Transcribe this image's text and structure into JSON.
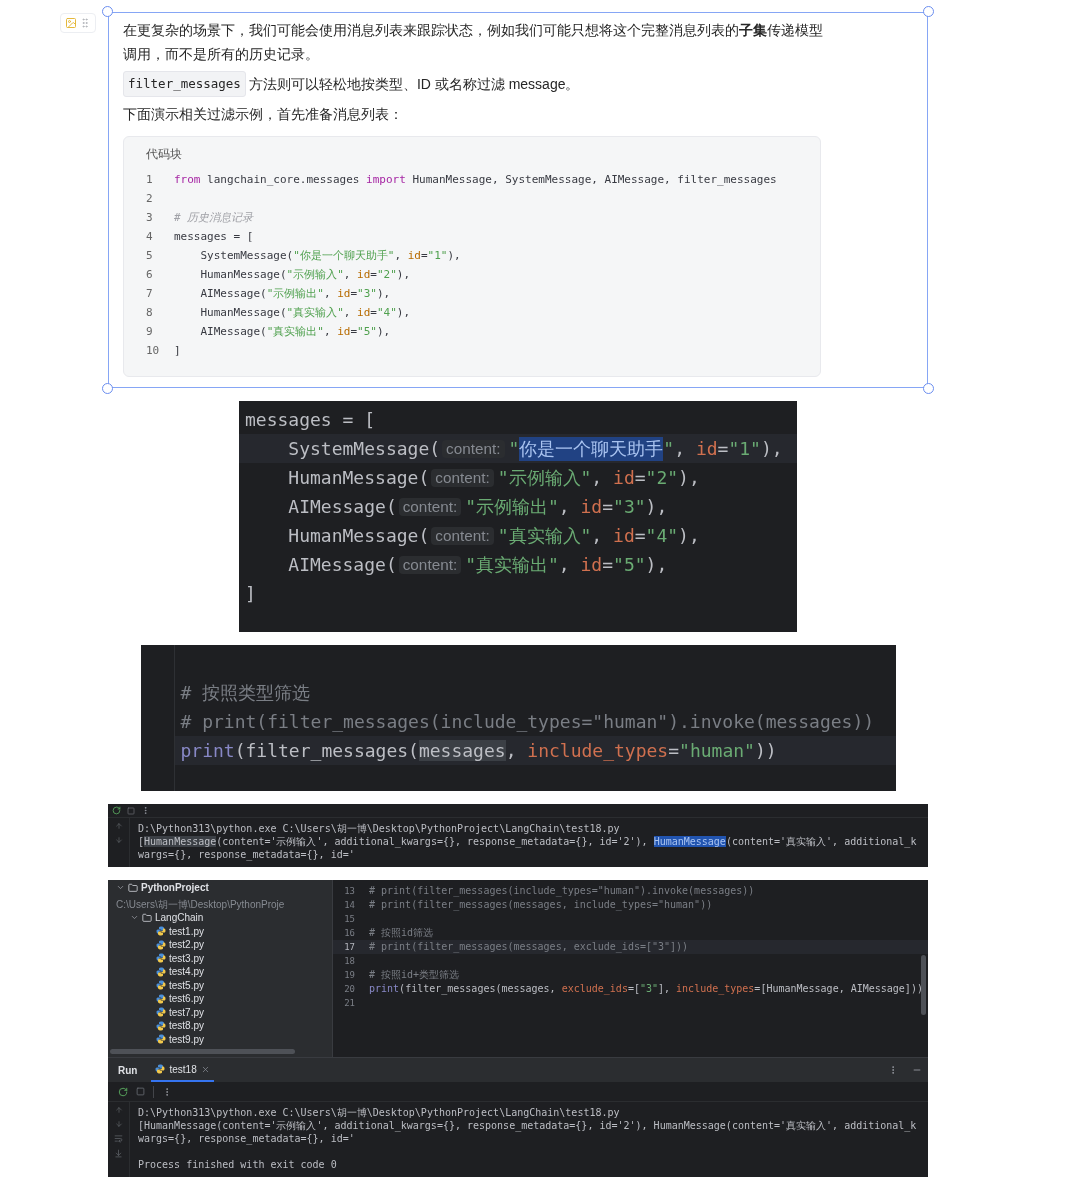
{
  "doc_block": {
    "paragraphs": [
      {
        "kind": "text",
        "text": "在更复杂的场景下，我们可能会使用消息列表来跟踪状态，例如我们可能只想将这个完整消息列表的**子集**传递模型调用，而不是所有的历史记录。"
      },
      {
        "kind": "code_lead",
        "code": "filter_messages",
        "text": "方法则可以轻松地按类型、ID 或名称过滤 message。"
      },
      {
        "kind": "text",
        "text": "下面演示相关过滤示例，首先准备消息列表："
      }
    ],
    "code_block": {
      "label": "代码块",
      "lines": [
        {
          "number": "1",
          "tokens": [
            {
              "kind": "keyword",
              "text": "from"
            },
            {
              "kind": "plain",
              "text": " langchain_core.messages "
            },
            {
              "kind": "keyword",
              "text": "import"
            },
            {
              "kind": "plain",
              "text": " HumanMessage, SystemMessage, AIMessage, filter_messages"
            }
          ]
        },
        {
          "number": "2"
        },
        {
          "number": "3",
          "tokens": [
            {
              "kind": "comment",
              "text": "# 历史消息记录"
            }
          ]
        },
        {
          "number": "4",
          "tokens": [
            {
              "kind": "plain",
              "text": "messages = ["
            }
          ]
        },
        {
          "number": "5",
          "tokens": [
            {
              "kind": "plain",
              "text": "    SystemMessage("
            },
            {
              "kind": "string",
              "text": "\"你是一个聊天助手\""
            },
            {
              "kind": "plain",
              "text": ", "
            },
            {
              "kind": "param",
              "text": "id"
            },
            {
              "kind": "plain",
              "text": "="
            },
            {
              "kind": "string",
              "text": "\"1\""
            },
            {
              "kind": "plain",
              "text": "),"
            }
          ]
        },
        {
          "number": "6",
          "tokens": [
            {
              "kind": "plain",
              "text": "    HumanMessage("
            },
            {
              "kind": "string",
              "text": "\"示例输入\""
            },
            {
              "kind": "plain",
              "text": ", "
            },
            {
              "kind": "param",
              "text": "id"
            },
            {
              "kind": "plain",
              "text": "="
            },
            {
              "kind": "string",
              "text": "\"2\""
            },
            {
              "kind": "plain",
              "text": "),"
            }
          ]
        },
        {
          "number": "7",
          "tokens": [
            {
              "kind": "plain",
              "text": "    AIMessage("
            },
            {
              "kind": "string",
              "text": "\"示例输出\""
            },
            {
              "kind": "plain",
              "text": ", "
            },
            {
              "kind": "param",
              "text": "id"
            },
            {
              "kind": "plain",
              "text": "="
            },
            {
              "kind": "string",
              "text": "\"3\""
            },
            {
              "kind": "plain",
              "text": "),"
            }
          ]
        },
        {
          "number": "8",
          "tokens": [
            {
              "kind": "plain",
              "text": "    HumanMessage("
            },
            {
              "kind": "string",
              "text": "\"真实输入\""
            },
            {
              "kind": "plain",
              "text": ", "
            },
            {
              "kind": "param",
              "text": "id"
            },
            {
              "kind": "plain",
              "text": "="
            },
            {
              "kind": "string",
              "text": "\"4\""
            },
            {
              "kind": "plain",
              "text": "),"
            }
          ]
        },
        {
          "number": "9",
          "tokens": [
            {
              "kind": "plain",
              "text": "    AIMessage("
            },
            {
              "kind": "string",
              "text": "\"真实输出\""
            },
            {
              "kind": "plain",
              "text": ", "
            },
            {
              "kind": "param",
              "text": "id"
            },
            {
              "kind": "plain",
              "text": "="
            },
            {
              "kind": "string",
              "text": "\"5\""
            },
            {
              "kind": "plain",
              "text": "),"
            }
          ]
        },
        {
          "number": "10",
          "tokens": [
            {
              "kind": "plain",
              "text": "]"
            }
          ]
        }
      ]
    }
  },
  "ide_snippet_messages": {
    "lines": [
      {
        "current": false,
        "tokens": [
          {
            "kind": "plain",
            "text": "messages = ["
          }
        ]
      },
      {
        "current": true,
        "tokens": [
          {
            "kind": "plain",
            "text": "    SystemMessage("
          },
          {
            "kind": "hint",
            "text": "content:"
          },
          {
            "kind": "string",
            "text": "\""
          },
          {
            "kind": "selected",
            "text": "你是一个聊天助手"
          },
          {
            "kind": "string",
            "text": "\""
          },
          {
            "kind": "plain",
            "text": ", "
          },
          {
            "kind": "param",
            "text": "id"
          },
          {
            "kind": "plain",
            "text": "="
          },
          {
            "kind": "string",
            "text": "\"1\""
          },
          {
            "kind": "plain",
            "text": "),"
          }
        ]
      },
      {
        "current": false,
        "tokens": [
          {
            "kind": "plain",
            "text": "    HumanMessage("
          },
          {
            "kind": "hint",
            "text": "content:"
          },
          {
            "kind": "string",
            "text": "\"示例输入\""
          },
          {
            "kind": "plain",
            "text": ", "
          },
          {
            "kind": "param",
            "text": "id"
          },
          {
            "kind": "plain",
            "text": "="
          },
          {
            "kind": "string",
            "text": "\"2\""
          },
          {
            "kind": "plain",
            "text": "),"
          }
        ]
      },
      {
        "current": false,
        "tokens": [
          {
            "kind": "plain",
            "text": "    AIMessage("
          },
          {
            "kind": "hint",
            "text": "content:"
          },
          {
            "kind": "string",
            "text": "\"示例输出\""
          },
          {
            "kind": "plain",
            "text": ", "
          },
          {
            "kind": "param",
            "text": "id"
          },
          {
            "kind": "plain",
            "text": "="
          },
          {
            "kind": "string",
            "text": "\"3\""
          },
          {
            "kind": "plain",
            "text": "),"
          }
        ]
      },
      {
        "current": false,
        "tokens": [
          {
            "kind": "plain",
            "text": "    HumanMessage("
          },
          {
            "kind": "hint",
            "text": "content:"
          },
          {
            "kind": "string",
            "text": "\"真实输入\""
          },
          {
            "kind": "plain",
            "text": ", "
          },
          {
            "kind": "param",
            "text": "id"
          },
          {
            "kind": "plain",
            "text": "="
          },
          {
            "kind": "string",
            "text": "\"4\""
          },
          {
            "kind": "plain",
            "text": "),"
          }
        ]
      },
      {
        "current": false,
        "tokens": [
          {
            "kind": "plain",
            "text": "    AIMessage("
          },
          {
            "kind": "hint",
            "text": "content:"
          },
          {
            "kind": "string",
            "text": "\"真实输出\""
          },
          {
            "kind": "plain",
            "text": ", "
          },
          {
            "kind": "param",
            "text": "id"
          },
          {
            "kind": "plain",
            "text": "="
          },
          {
            "kind": "string",
            "text": "\"5\""
          },
          {
            "kind": "plain",
            "text": "),"
          }
        ]
      },
      {
        "current": false,
        "tokens": [
          {
            "kind": "plain",
            "text": "]"
          }
        ]
      }
    ]
  },
  "ide_snippet_filter": {
    "lines": [
      {
        "current": false
      },
      {
        "current": false,
        "tokens": [
          {
            "kind": "comment",
            "text": "# 按照类型筛选"
          }
        ]
      },
      {
        "current": false,
        "tokens": [
          {
            "kind": "comment",
            "text": "# print(filter_messages(include_types=\"human\").invoke(messages))"
          }
        ]
      },
      {
        "current": true,
        "tokens": [
          {
            "kind": "builtin",
            "text": "print"
          },
          {
            "kind": "plain",
            "text": "(filter_messages("
          },
          {
            "kind": "highlight",
            "text": "messages"
          },
          {
            "kind": "plain",
            "text": ", "
          },
          {
            "kind": "param",
            "text": "include_types"
          },
          {
            "kind": "plain",
            "text": "="
          },
          {
            "kind": "string",
            "text": "\"human\""
          },
          {
            "kind": "plain",
            "text": "))"
          }
        ]
      }
    ]
  },
  "console_snippet": {
    "lines": [
      {
        "tokens": [
          {
            "kind": "plain",
            "text": "D:\\Python313\\python.exe C:\\Users\\胡一博\\Desktop\\PythonProject\\LangChain\\test18.py"
          }
        ]
      },
      {
        "tokens": [
          {
            "kind": "plain",
            "text": "["
          },
          {
            "kind": "highlight",
            "text": "HumanMessage"
          },
          {
            "kind": "plain",
            "text": "(content='示例输入', additional_kwargs={}, response_metadata={}, id='2'), "
          },
          {
            "kind": "selected",
            "text": "HumanMessage"
          },
          {
            "kind": "plain",
            "text": "(content='真实输入', additional_kwargs={}, response_metadata={}, id='"
          }
        ]
      }
    ]
  },
  "ide_window": {
    "project_tree": [
      {
        "kind": "folder",
        "label": "PythonProject",
        "path": "C:\\Users\\胡一博\\Desktop\\PythonProje",
        "expanded": true,
        "children": [
          {
            "kind": "folder",
            "label": "LangChain",
            "expanded": true,
            "children": [
              {
                "kind": "file",
                "label": "test1.py"
              },
              {
                "kind": "file",
                "label": "test2.py"
              },
              {
                "kind": "file",
                "label": "test3.py"
              },
              {
                "kind": "file",
                "label": "test4.py"
              },
              {
                "kind": "file",
                "label": "test5.py"
              },
              {
                "kind": "file",
                "label": "test6.py"
              },
              {
                "kind": "file",
                "label": "test7.py"
              },
              {
                "kind": "file",
                "label": "test8.py"
              },
              {
                "kind": "file",
                "label": "test9.py"
              }
            ]
          }
        ]
      }
    ],
    "editor_lines": [
      {
        "number": "13",
        "current": false,
        "tokens": [
          {
            "kind": "comment",
            "text": "# print(filter_messages(include_types=\"human\").invoke(messages))"
          }
        ]
      },
      {
        "number": "14",
        "current": false,
        "tokens": [
          {
            "kind": "comment",
            "text": "# print(filter_messages(messages, include_types=\"human\"))"
          }
        ]
      },
      {
        "number": "15",
        "current": false
      },
      {
        "number": "16",
        "current": false,
        "tokens": [
          {
            "kind": "comment",
            "text": "# 按照id筛选"
          }
        ]
      },
      {
        "number": "17",
        "current": true,
        "tokens": [
          {
            "kind": "comment",
            "text": "# print(filter_messages(messages, exclude_ids=[\"3\"]))"
          }
        ]
      },
      {
        "number": "18",
        "current": false
      },
      {
        "number": "19",
        "current": false,
        "tokens": [
          {
            "kind": "comment",
            "text": "# 按照id+类型筛选"
          }
        ]
      },
      {
        "number": "20",
        "current": false,
        "tokens": [
          {
            "kind": "builtin",
            "text": "print"
          },
          {
            "kind": "plain",
            "text": "(filter_messages(messages, "
          },
          {
            "kind": "param",
            "text": "exclude_ids"
          },
          {
            "kind": "plain",
            "text": "=["
          },
          {
            "kind": "string",
            "text": "\"3\""
          },
          {
            "kind": "plain",
            "text": "], "
          },
          {
            "kind": "param",
            "text": "include_types"
          },
          {
            "kind": "plain",
            "text": "=[HumanMessage, AIMessage]))"
          }
        ]
      },
      {
        "number": "21",
        "current": false
      }
    ],
    "run_panel": {
      "title": "Run",
      "tabs": [
        {
          "label": "test18",
          "selected": true
        }
      ],
      "console": [
        {
          "tokens": [
            {
              "kind": "plain",
              "text": "D:\\Python313\\python.exe C:\\Users\\胡一博\\Desktop\\PythonProject\\LangChain\\test18.py"
            }
          ]
        },
        {
          "tokens": [
            {
              "kind": "plain",
              "text": "[HumanMessage(content='示例输入', additional_kwargs={}, response_metadata={}, id='2'), HumanMessage(content='真实输入', additional_kwargs={}, response_metadata={}, id='"
            }
          ]
        },
        {
          "kind": "status",
          "tokens": [
            {
              "kind": "plain",
              "text": "Process finished with exit code 0"
            }
          ]
        }
      ]
    }
  }
}
